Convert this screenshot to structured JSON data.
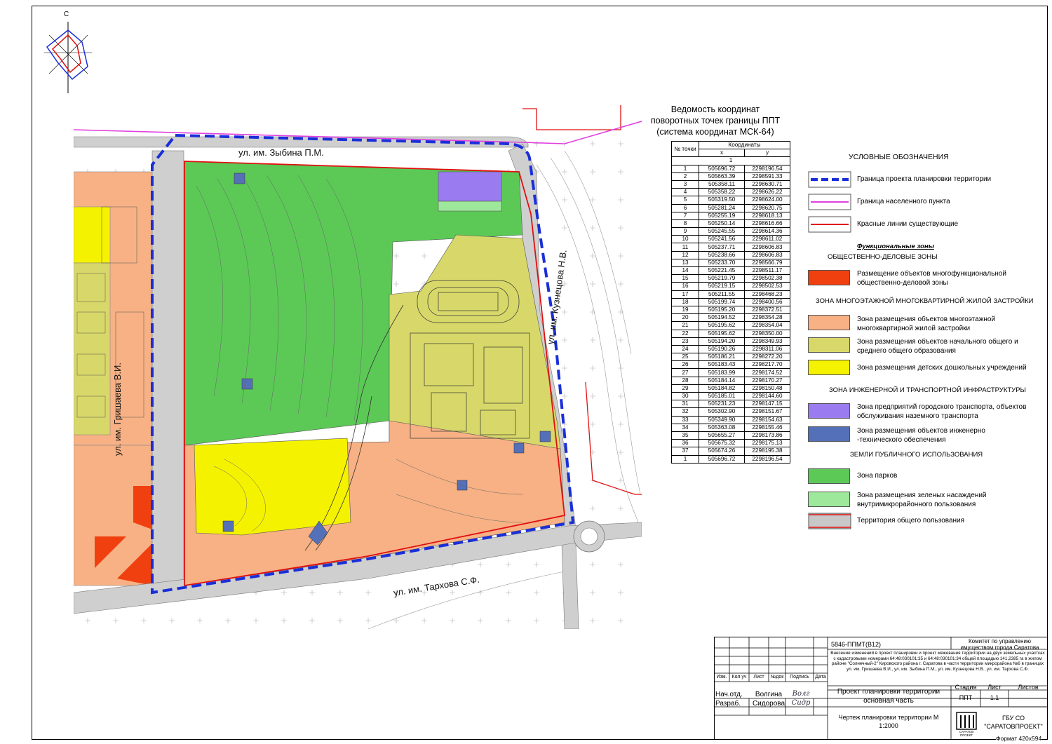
{
  "compass": {
    "north_label": "С"
  },
  "streets": {
    "zybina": "ул. им. Зыбина П.М.",
    "grishaeva": "ул. им. Гришаева В.И.",
    "kuznetsova": "ул. им. Кузнецова Н.В.",
    "tarkhova": "ул. им. Тархова С.Ф."
  },
  "coord_table": {
    "title": "Ведомость координат поворотных точек границы ППТ (система координат МСК-64)",
    "head_no": "№ точки",
    "head_coords": "Координаты",
    "head_x": "x",
    "head_y": "y",
    "head_ring": "1",
    "rows": [
      [
        "1",
        "505696.72",
        "2298196.54"
      ],
      [
        "2",
        "505663.39",
        "2298591.33"
      ],
      [
        "3",
        "505358.11",
        "2298630.71"
      ],
      [
        "4",
        "505358.22",
        "2298626.22"
      ],
      [
        "5",
        "505319.50",
        "2298624.00"
      ],
      [
        "6",
        "505281.24",
        "2298620.75"
      ],
      [
        "7",
        "505255.19",
        "2298618.13"
      ],
      [
        "8",
        "505250.14",
        "2298616.66"
      ],
      [
        "9",
        "505245.55",
        "2298614.36"
      ],
      [
        "10",
        "505241.56",
        "2298611.02"
      ],
      [
        "11",
        "505237.71",
        "2298606.83"
      ],
      [
        "12",
        "505238.66",
        "2298606.83"
      ],
      [
        "13",
        "505233.70",
        "2298566.79"
      ],
      [
        "14",
        "505221.45",
        "2298511.17"
      ],
      [
        "15",
        "505219.79",
        "2298502.38"
      ],
      [
        "16",
        "505219.15",
        "2298502.53"
      ],
      [
        "17",
        "505211.55",
        "2298468.23"
      ],
      [
        "18",
        "505199.74",
        "2298400.56"
      ],
      [
        "19",
        "505195.20",
        "2298372.51"
      ],
      [
        "20",
        "505194.52",
        "2298354.28"
      ],
      [
        "21",
        "505195.62",
        "2298354.04"
      ],
      [
        "22",
        "505195.62",
        "2298350.00"
      ],
      [
        "23",
        "505194.20",
        "2298349.93"
      ],
      [
        "24",
        "505190.26",
        "2298311.06"
      ],
      [
        "25",
        "505186.21",
        "2298272.20"
      ],
      [
        "26",
        "505183.43",
        "2298217.70"
      ],
      [
        "27",
        "505183.99",
        "2298174.52"
      ],
      [
        "28",
        "505184.14",
        "2298170.27"
      ],
      [
        "29",
        "505184.82",
        "2298150.48"
      ],
      [
        "30",
        "505185.01",
        "2298144.60"
      ],
      [
        "31",
        "505231.23",
        "2298147.15"
      ],
      [
        "32",
        "505302.90",
        "2298151.67"
      ],
      [
        "33",
        "505349.90",
        "2298154.63"
      ],
      [
        "34",
        "505363.08",
        "2298155.46"
      ],
      [
        "35",
        "505655.27",
        "2298173.86"
      ],
      [
        "36",
        "505675.32",
        "2298175.13"
      ],
      [
        "37",
        "505674.26",
        "2298195.38"
      ],
      [
        "1",
        "505696.72",
        "2298196.54"
      ]
    ]
  },
  "legend": {
    "title": "УСЛОВНЫЕ ОБОЗНАЧЕНИЯ",
    "line_items": [
      {
        "label": "Граница проекта планировки территории",
        "color": "#1a2fd8"
      },
      {
        "label": "Граница населенного пункта",
        "color": "#e040e0"
      },
      {
        "label": "Красные линии существующие",
        "color": "#e01010"
      }
    ],
    "func_zones": "Функциональные зоны",
    "h_business": "ОБЩЕСТВЕННО-ДЕЛОВЫЕ ЗОНЫ",
    "business": "Размещение объектов многофункциональной общественно-деловой зоны",
    "h_residential": "ЗОНА МНОГОЭТАЖНОЙ  МНОГОКВАРТИРНОЙ ЖИЛОЙ ЗАСТРОЙКИ",
    "residential": "Зона размещения объектов многоэтажной многоквартирной жилой застройки",
    "school": "Зона размещения объектов начального общего и среднего общего образования",
    "kinder": "Зона размещения детских дошкольных учреждений",
    "h_infra": "ЗОНА ИНЖЕНЕРНОЙ И ТРАНСПОРТНОЙ ИНФРАСТРУКТУРЫ",
    "transport": "Зона предприятий городского транспорта, объектов обслуживания наземного транспорта",
    "engineering": "Зона размещения объектов инженерно -технического обеспечения",
    "h_public": "ЗЕМЛИ  ПУБЛИЧНОГО ИСПОЛЬЗОВАНИЯ",
    "parks": "Зона парков",
    "greens": "Зона размещения зеленых насаждений внутримикрорайонного пользования",
    "common": "Территория общего пользования",
    "colors": {
      "business": "#f04010",
      "residential": "#f7b184",
      "school": "#d8d86a",
      "kinder": "#f5f200",
      "transport": "#9a7cf0",
      "engineering": "#5470b8",
      "parks": "#5cc957",
      "greens": "#9de89a",
      "common": "#c8c8c8"
    }
  },
  "title_block": {
    "code": "5846-ППМТ(В12)",
    "client": "Комитет по управлению имуществом города Саратова",
    "description": "Внесение изменений в проект планировки и проект межевания территории на двух земельных участках с кадастровыми номерами 64:48:030101:35 и 64:48:030101:34 общей площадью 141,2385 га в жилом районе \"Солнечный-2\" Кировского района г. Саратова в части территории микрорайона №6 в границах ул. им. Гришаева В.И., ул. им. Зыбина П.М., ул. им. Кузнецова Н.В., ул. им. Тархова С.Ф.",
    "cols": [
      "Изм.",
      "Кол.уч",
      "Лист",
      "№док",
      "Подпись",
      "Дата"
    ],
    "role1": "Нач.отд.",
    "name1": "Волгина",
    "sig1": "Волг",
    "role2": "Разраб.",
    "name2": "Сидорова",
    "sig2": "Сидр",
    "project": "Проект планировки территории основная часть",
    "stage_h": "Стадия",
    "sheet_h": "Лист",
    "sheets_h": "Листов",
    "stage": "ППТ",
    "sheet": "1.1",
    "sheets": "",
    "drawing": "Чертеж планировки территории М 1:2000",
    "org": "ГБУ СО \"САРАТОВПРОЕКТ\"",
    "logo_text": "САРАТОВ ПРОЕКТ"
  },
  "format": "Формат 420х594"
}
